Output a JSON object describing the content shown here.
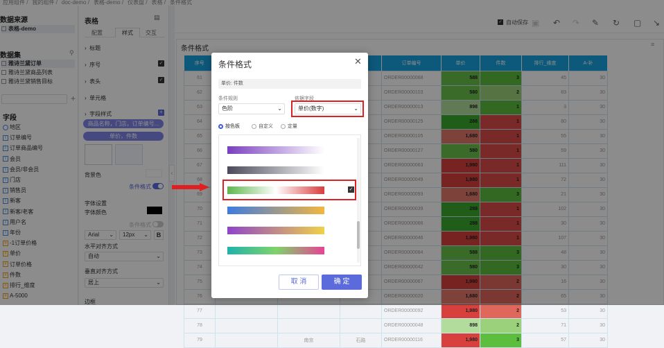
{
  "topbar": {
    "crumbs": [
      "应用组件",
      "我的组件",
      "doc-demo",
      "表格-demo",
      "仪表盘",
      "表格",
      "条件格式"
    ]
  },
  "left": {
    "source_title": "数据来源",
    "source_item": "表格-demo",
    "dataset_title": "数据集",
    "datasets": [
      "雅诗兰黛订单",
      "雅诗兰黛商品列表",
      "雅诗兰黛销售目标"
    ],
    "fields_title": "字段",
    "fields": [
      {
        "label": "地区",
        "type": "geo"
      },
      {
        "label": "订单编号",
        "type": "T"
      },
      {
        "label": "订单商品编号",
        "type": "T"
      },
      {
        "label": "会员",
        "type": "T"
      },
      {
        "label": "会员/非会员",
        "type": "T"
      },
      {
        "label": "门店",
        "type": "T"
      },
      {
        "label": "销售员",
        "type": "T"
      },
      {
        "label": "新客",
        "type": "T"
      },
      {
        "label": "新客/老客",
        "type": "T"
      },
      {
        "label": "用户名",
        "type": "T"
      },
      {
        "label": "年份",
        "type": "T"
      },
      {
        "label": "-1订单价格",
        "type": "#"
      },
      {
        "label": "单价",
        "type": "#"
      },
      {
        "label": "订单价格",
        "type": "#"
      },
      {
        "label": "件数",
        "type": "#"
      },
      {
        "label": "排行_维度",
        "type": "#"
      },
      {
        "label": "A-5000",
        "type": "#"
      }
    ]
  },
  "mid": {
    "title": "表格",
    "tabs": [
      "配置",
      "样式",
      "交互"
    ],
    "sections": [
      "标题",
      "序号",
      "表头",
      "单元格"
    ],
    "field_style_label": "字段样式",
    "pill1": "商品名称，门店，订单编号...",
    "pill2": "单价，件数",
    "bg_label": "背景色",
    "cond_label": "条件格式",
    "font_settings": "字体设置",
    "font_color": "字体颜色",
    "cond_label2": "条件格式",
    "font_family": "Arial",
    "font_size": "12px",
    "bold": "B",
    "h_align_label": "水平对齐方式",
    "h_align": "自动",
    "v_align_label": "垂直对齐方式",
    "v_align": "居上",
    "border_label": "边框"
  },
  "toolbar": {
    "autosave": "自动保存"
  },
  "card_title": "条件格式",
  "table": {
    "headers": [
      "序号",
      "",
      "",
      "",
      "订单编号",
      "单价",
      "件数",
      "排行_维度",
      "A-补"
    ],
    "rows": [
      {
        "seq": "61",
        "order": "ORDER00000068",
        "price": "588",
        "qty": "3",
        "rank": "45",
        "a": "30",
        "pc": "#69c24a",
        "qc": "#5cbd3f"
      },
      {
        "seq": "62",
        "order": "ORDER00000103",
        "price": "580",
        "qty": "2",
        "rank": "83",
        "a": "30",
        "pc": "#6bc34c",
        "qc": "#9bd17a"
      },
      {
        "seq": "63",
        "order": "ORDER00000013",
        "price": "898",
        "qty": "1",
        "rank": "3",
        "a": "30",
        "pc": "#b2dc9c",
        "qc": "#5cbd3f"
      },
      {
        "seq": "64",
        "order": "ORDER00000125",
        "price": "288",
        "qty": "1",
        "rank": "80",
        "a": "30",
        "pc": "#3aaa2e",
        "qc": "#dc4b48"
      },
      {
        "seq": "65",
        "order": "ORDER00000105",
        "price": "1,680",
        "qty": "1",
        "rank": "55",
        "a": "30",
        "pc": "#e47a6c",
        "qc": "#dc4b48"
      },
      {
        "seq": "66",
        "order": "ORDER00000127",
        "price": "580",
        "qty": "1",
        "rank": "59",
        "a": "30",
        "pc": "#6bc34c",
        "qc": "#dc4b48"
      },
      {
        "seq": "67",
        "order": "ORDER00000063",
        "price": "1,980",
        "qty": "1",
        "rank": "111",
        "a": "30",
        "pc": "#d8403d",
        "qc": "#dc4b48"
      },
      {
        "seq": "68",
        "order": "ORDER00000049",
        "price": "1,980",
        "qty": "1",
        "rank": "72",
        "a": "30",
        "pc": "#d8403d",
        "qc": "#dc4b48"
      },
      {
        "seq": "69",
        "order": "ORDER00000093",
        "price": "1,680",
        "qty": "3",
        "rank": "21",
        "a": "30",
        "pc": "#e47a6c",
        "qc": "#5cbd3f"
      },
      {
        "seq": "70",
        "order": "ORDER00000039",
        "price": "288",
        "qty": "1",
        "rank": "102",
        "a": "30",
        "pc": "#3aaa2e",
        "qc": "#dc4b48"
      },
      {
        "seq": "71",
        "order": "ORDER00000066",
        "price": "288",
        "qty": "1",
        "rank": "30",
        "a": "30",
        "pc": "#3aaa2e",
        "qc": "#dc4b48"
      },
      {
        "seq": "72",
        "order": "ORDER00000046",
        "price": "1,980",
        "qty": "1",
        "rank": "107",
        "a": "30",
        "pc": "#d8403d",
        "qc": "#dc4b48"
      },
      {
        "seq": "73",
        "order": "ORDER00000084",
        "price": "588",
        "qty": "3",
        "rank": "48",
        "a": "30",
        "pc": "#69c24a",
        "qc": "#5cbd3f"
      },
      {
        "seq": "74",
        "order": "ORDER00000042",
        "price": "580",
        "qty": "3",
        "rank": "30",
        "a": "30",
        "pc": "#6bc34c",
        "qc": "#5cbd3f"
      },
      {
        "seq": "75",
        "order": "ORDER00000067",
        "price": "1,980",
        "qty": "2",
        "rank": "16",
        "a": "30",
        "pc": "#d8403d",
        "qc": "#e0675c"
      },
      {
        "seq": "76",
        "order": "ORDER00000020",
        "price": "1,680",
        "qty": "2",
        "rank": "65",
        "a": "30",
        "pc": "#e47a6c",
        "qc": "#e0675c"
      },
      {
        "seq": "77",
        "order": "ORDER00000092",
        "price": "1,980",
        "qty": "2",
        "rank": "53",
        "a": "30",
        "pc": "#d8403d",
        "qc": "#e0675c"
      },
      {
        "seq": "78",
        "order": "ORDER00000048",
        "price": "898",
        "qty": "2",
        "rank": "71",
        "a": "30",
        "pc": "#b2dc9c",
        "qc": "#9bd17a"
      },
      {
        "seq": "79",
        "order": "ORDER00000116",
        "price": "1,980",
        "qty": "3",
        "rank": "57",
        "a": "30",
        "pc": "#d8403d",
        "qc": "#5cbd3f"
      }
    ],
    "partial_cells": [
      "南京",
      "石路"
    ]
  },
  "dialog": {
    "title": "条件格式",
    "field_tag": "单价: 件数",
    "rule_label": "条件规则",
    "rule_value": "色阶",
    "basis_label": "依据字段",
    "basis_value": "单价(数字)",
    "radios": [
      "按色板",
      "自定义",
      "定量"
    ],
    "palettes": [
      {
        "from": "#7a3fc1",
        "to": "#ffffff"
      },
      {
        "from": "#4a4a5a",
        "to": "#ffffff"
      },
      {
        "from": "#5fb64e",
        "mid": "#ffffff",
        "to": "#d93c3c",
        "selected": true
      },
      {
        "from": "#3e7be0",
        "to": "#f2b640"
      },
      {
        "from": "#8e44c9",
        "to": "#f0d14a"
      },
      {
        "from": "#20b2aa",
        "mid": "#7ed36a",
        "to": "#e84393"
      }
    ],
    "cancel": "取 消",
    "ok": "确 定"
  }
}
